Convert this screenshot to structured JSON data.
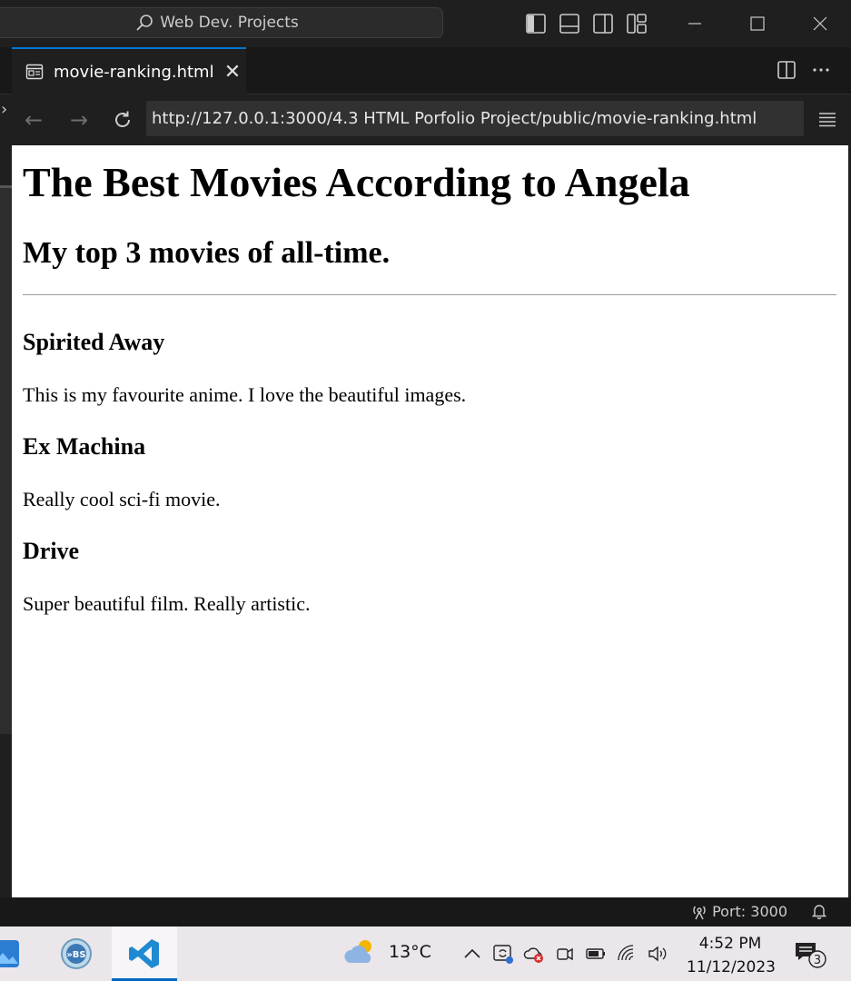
{
  "titlebar": {
    "command_center": "Web Dev. Projects"
  },
  "tab": {
    "label": "movie-ranking.html",
    "close": "✕"
  },
  "browser": {
    "url": "http://127.0.0.1:3000/4.3 HTML Porfolio Project/public/movie-ranking.html"
  },
  "page": {
    "title": "The Best Movies According to Angela",
    "subtitle": "My top 3 movies of all-time.",
    "movies": [
      {
        "name": "Spirited Away",
        "description": "This is my favourite anime. I love the beautiful images."
      },
      {
        "name": "Ex Machina",
        "description": "Really cool sci-fi movie."
      },
      {
        "name": "Drive",
        "description": "Super beautiful film. Really artistic."
      }
    ]
  },
  "statusbar": {
    "port": "Port: 3000"
  },
  "taskbar": {
    "temperature": "13°C",
    "time": "4:52 PM",
    "date": "11/12/2023",
    "notification_count": "3"
  },
  "colors": {
    "accent": "#0078d4",
    "editor_bg": "#1f1f1f",
    "page_bg": "#ffffff",
    "taskbar_bg": "#eae6ea"
  }
}
